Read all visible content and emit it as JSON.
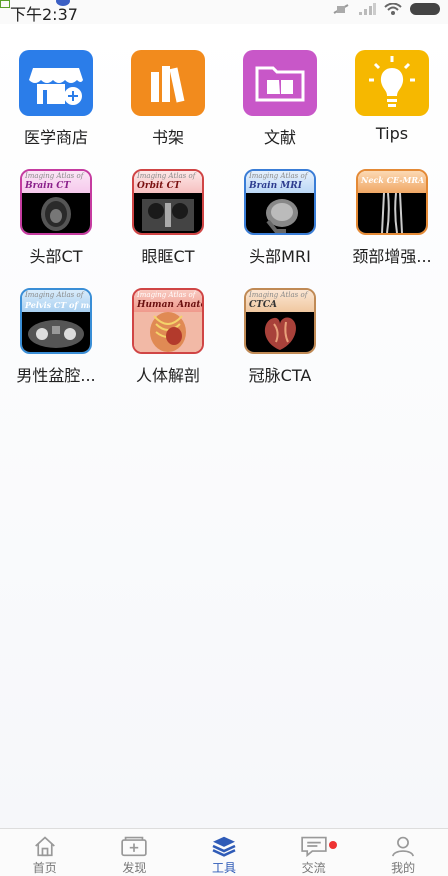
{
  "status_bar": {
    "time": "下午2:37"
  },
  "tools": [
    {
      "label": "医学商店",
      "icon": "store-icon",
      "color": "#2b7de9"
    },
    {
      "label": "书架",
      "icon": "bookshelf-icon",
      "color": "#f28b1d"
    },
    {
      "label": "文献",
      "icon": "folder-book-icon",
      "color": "#c857c8"
    },
    {
      "label": "Tips",
      "icon": "lightbulb-icon",
      "color": "#f6b800"
    },
    {
      "label": "头部CT",
      "atlas_series": "Imaging Atlas of",
      "atlas_title": "Brain CT",
      "frame": "#c53ca0"
    },
    {
      "label": "眼眶CT",
      "atlas_series": "Imaging Atlas of",
      "atlas_title": "Orbit CT",
      "frame": "#d04545"
    },
    {
      "label": "头部MRI",
      "atlas_series": "Imaging Atlas of",
      "atlas_title": "Brain MRI",
      "frame": "#3a7dd6"
    },
    {
      "label": "颈部增强...",
      "atlas_series": "",
      "atlas_title": "Neck CE-MRA",
      "frame": "#e48a36"
    },
    {
      "label": "男性盆腔...",
      "atlas_series": "Imaging Atlas of",
      "atlas_title": "Pelvis CT of male",
      "frame": "#3a8ed6"
    },
    {
      "label": "人体解剖",
      "atlas_series": "Imaging Atlas of",
      "atlas_title": "Human Anatomy",
      "frame": "#d04545"
    },
    {
      "label": "冠脉CTA",
      "atlas_series": "Imaging Atlas of",
      "atlas_title": "CTCA",
      "frame": "#c08a55"
    }
  ],
  "tabbar": {
    "items": [
      {
        "label": "首页",
        "icon": "home-icon"
      },
      {
        "label": "发现",
        "icon": "discover-icon"
      },
      {
        "label": "工具",
        "icon": "tools-layers-icon",
        "active": true
      },
      {
        "label": "交流",
        "icon": "chat-icon",
        "badge": true
      },
      {
        "label": "我的",
        "icon": "profile-icon"
      }
    ]
  }
}
